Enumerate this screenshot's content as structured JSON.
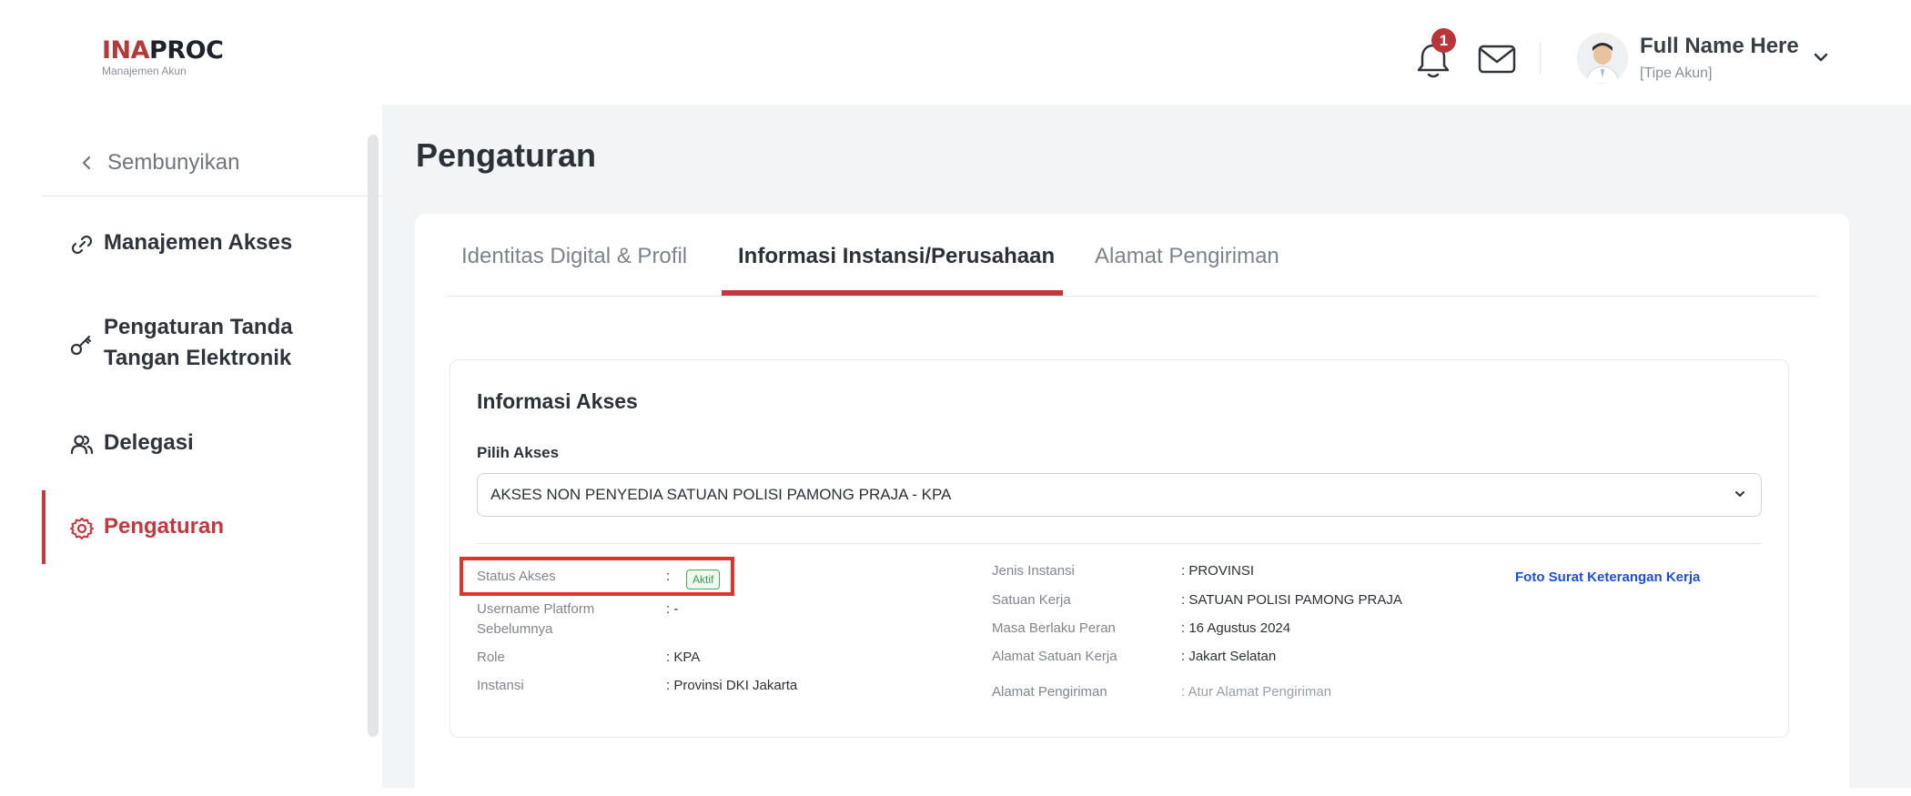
{
  "header": {
    "logo_ina": "INA",
    "logo_proc": "PROC",
    "logo_sub": "Manajemen Akun",
    "notification_count": "1",
    "user_name": "Full Name Here",
    "user_type": "[Tipe Akun]"
  },
  "sidebar": {
    "hide_label": "Sembunyikan",
    "items": [
      {
        "label": "Manajemen Akses",
        "icon": "link-icon"
      },
      {
        "label": "Pengaturan Tanda Tangan Elektronik",
        "icon": "key-icon"
      },
      {
        "label": "Delegasi",
        "icon": "users-icon"
      },
      {
        "label": "Pengaturan",
        "icon": "gear-icon",
        "active": true
      }
    ]
  },
  "main": {
    "page_title": "Pengaturan",
    "tabs": [
      {
        "label": "Identitas Digital & Profil"
      },
      {
        "label": "Informasi Instansi/Perusahaan",
        "active": true
      },
      {
        "label": "Alamat Pengiriman"
      }
    ],
    "section_title": "Informasi Akses",
    "pilih_akses_label": "Pilih Akses",
    "pilih_akses_value": "AKSES NON PENYEDIA SATUAN POLISI PAMONG PRAJA - KPA",
    "left_info": {
      "status_label": "Status Akses",
      "status_value": "Aktif",
      "username_label_1": "Username Platform",
      "username_label_2": "Sebelumnya",
      "username_value": ": -",
      "role_label": "Role",
      "role_value": ": KPA",
      "instansi_label": "Instansi",
      "instansi_value": ": Provinsi DKI Jakarta"
    },
    "right_info": {
      "jenis_label": "Jenis Instansi",
      "jenis_value": ": PROVINSI",
      "satuan_label": "Satuan Kerja",
      "satuan_value": ": SATUAN POLISI PAMONG PRAJA",
      "masa_label": "Masa Berlaku Peran",
      "masa_value": ": 16 Agustus 2024",
      "alamat_satuan_label": "Alamat Satuan Kerja",
      "alamat_satuan_value": ": Jakart Selatan",
      "alamat_pengiriman_label": "Alamat Pengiriman",
      "alamat_pengiriman_value": ": Atur Alamat Pengiriman"
    },
    "foto_link": "Foto Surat Keterangan Kerja"
  },
  "colors": {
    "accent": "#c0393e",
    "link": "#1d4fd8",
    "highlight": "#e0332c"
  }
}
